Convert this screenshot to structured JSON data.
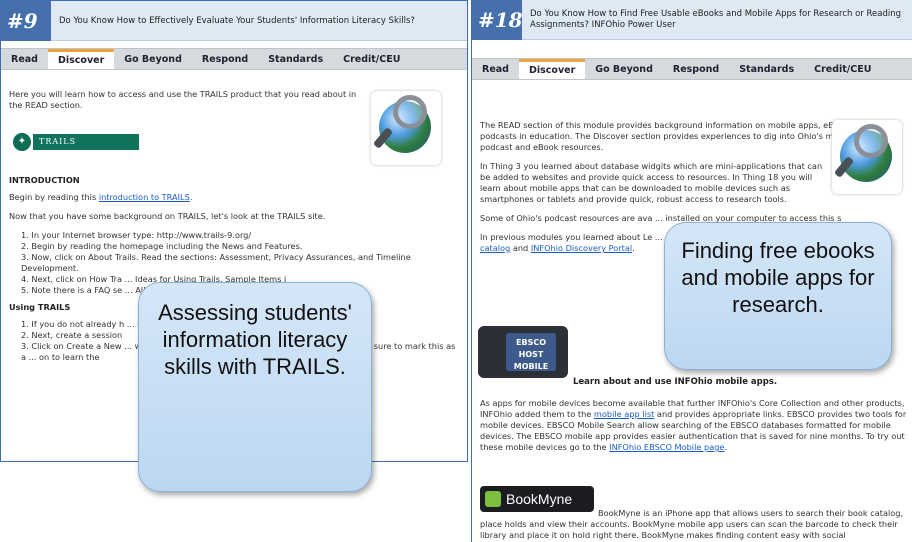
{
  "left": {
    "number": "#9",
    "title": "Do You Know How to Effectively Evaluate Your Students' Information Literacy Skills?",
    "tabs": [
      "Read",
      "Discover",
      "Go Beyond",
      "Respond",
      "Standards",
      "Credit/CEU"
    ],
    "intro": "Here you will learn how to access and use the TRAILS product that you read about in the READ section.",
    "logo_text": "TRAILS",
    "introduction_heading": "INTRODUCTION",
    "begin_prefix": "Begin by reading this ",
    "begin_link": "introduction to TRAILS",
    "begin_suffix": ".",
    "background": "Now that you have some background on TRAILS, let's look at the TRAILS site.",
    "steps": [
      "1. In your Internet browser type: http://www.trails-9.org/",
      "2. Begin by reading the homepage including the News and Features.",
      "3. Now, click on About Trails. Read the sections: Assessment, Privacy Assurances, and Timeline Development.",
      "4. Next, click on How Tra ... Ideas for Using Trails, Sample Items i",
      "5. Note there is a FAQ se ... AILS are answered in this secti"
    ],
    "using_heading": "Using TRAILS",
    "using_steps": [
      "1. If you do not already h ... llow the steps and create your own",
      "2. Next, create a session",
      "3. Click on Create a New ... w student codes so that you can experi ... th students, be sure to mark this as a ... on to learn the"
    ],
    "bubble": "Assessing students' information literacy skills with TRAILS."
  },
  "right": {
    "number": "#18",
    "title": "Do You Know How to Find Free Usable eBooks and Mobile Apps for Research or Reading Assignments? INFOhio Power User",
    "tabs": [
      "Read",
      "Discover",
      "Go Beyond",
      "Respond",
      "Standards",
      "Credit/CEU"
    ],
    "para1": "The READ section of this module provides background information on mobile apps, eBooks and podcasts in education. The Discover section provides experiences to dig into Ohio's mobile app, podcast and eBook resources.",
    "para2": "In Thing 3 you learned about database widgits which are mini-applications that can be added to websites and provide quick access to resources. In Thing 18 you will learn about mobile apps that can be downloaded to mobile devices such as smartphones or tablets and provide quick, robust access to research tools.",
    "para3": "Some of Ohio's podcast resources are ava ... installed on your computer to access this s",
    "para4_prefix": "In previous modules you learned about Le ... eBooks (Thing 15). INFOhio also provides",
    "para4_link1": "catalog",
    "para4_mid": " and ",
    "para4_link2": "INFOhio Discovery Portal",
    "para4_suffix": ".",
    "ebsco_label": "EBSCO HOST MOBILE",
    "learn_heading": "Learn about and use INFOhio mobile apps.",
    "para5_prefix": "As apps for mobile devices become available that further INFOhio's Core Collection and other products, INFOhio added them to the ",
    "para5_link": "mobile app list",
    "para5_mid": " and provides appropriate links. EBSCO provides two tools for mobile devices. EBSCO Mobile Search allow searching of the EBSCO databases formatted for mobile devices. The EBSCO mobile app provides easier authentication that is saved for nine months. To try out these mobile devices go to the ",
    "para5_link2": "INFOhio EBSCO Mobile page",
    "para5_suffix": ".",
    "bookmyne_label": "BookMyne",
    "para6": "BookMyne is an iPhone app that allows users to search their book catalog, place holds and view their accounts. BookMyne mobile app users can scan the barcode to check their library and place it on hold right there. BookMyne makes finding content easy with social",
    "bubble": "Finding free ebooks and mobile apps for research."
  }
}
